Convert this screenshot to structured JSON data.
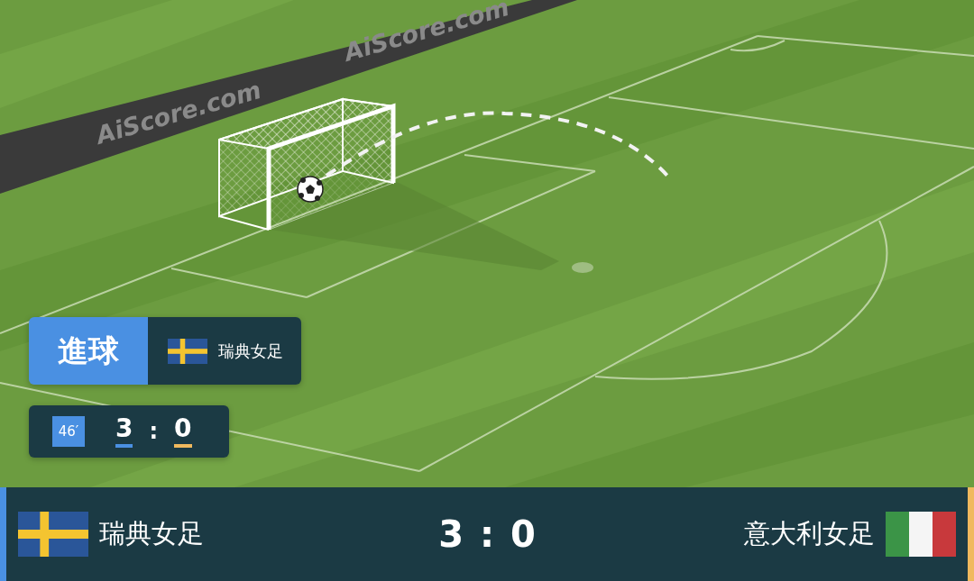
{
  "pitch": {
    "ad_texts": [
      "AiScore.com",
      "AiScore.com"
    ]
  },
  "event": {
    "kind": "goal",
    "label": "進球",
    "team": "瑞典女足",
    "team_flag": {
      "kind": "sweden"
    },
    "minute": "46′",
    "home_score": "3",
    "separator": ":",
    "away_score": "0"
  },
  "scoreboard": {
    "home": {
      "name": "瑞典女足",
      "flag": {
        "kind": "sweden"
      },
      "color": "#4a90e2"
    },
    "away": {
      "name": "意大利女足",
      "flag": {
        "kind": "italy"
      },
      "color": "#f0b95e"
    },
    "home_score": "3",
    "separator": ":",
    "away_score": "0"
  }
}
